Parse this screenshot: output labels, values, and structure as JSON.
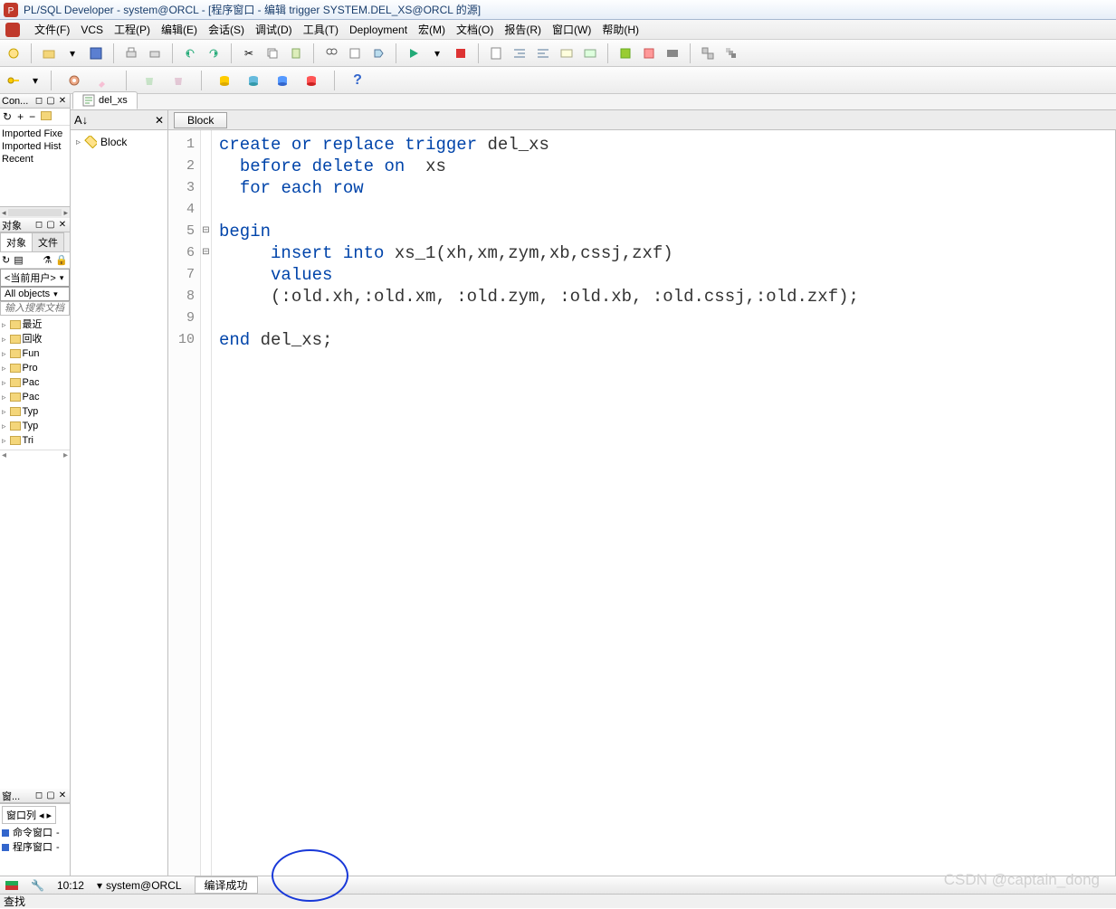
{
  "title": "PL/SQL Developer - system@ORCL - [程序窗口 - 编辑 trigger SYSTEM.DEL_XS@ORCL 的源]",
  "menus": [
    "文件(F)",
    "VCS",
    "工程(P)",
    "编辑(E)",
    "会话(S)",
    "调试(D)",
    "工具(T)",
    "Deployment",
    "宏(M)",
    "文档(O)",
    "报告(R)",
    "窗口(W)",
    "帮助(H)"
  ],
  "left": {
    "connections": {
      "title": "Con...",
      "rows": [
        "Imported Fixe",
        "Imported Hist",
        "Recent"
      ]
    },
    "objects": {
      "title": "对象",
      "tabs": [
        "对象",
        "文件"
      ],
      "user": "<当前用户>",
      "filter": "All objects",
      "search_placeholder": "输入搜索文档",
      "tree": [
        "最近",
        "回收",
        "Fun",
        "Pro",
        "Pac",
        "Pac",
        "Typ",
        "Typ",
        "Tri"
      ]
    },
    "windows": {
      "title": "窗...",
      "tab": "窗口列",
      "items": [
        "命令窗口",
        "程序窗口"
      ]
    }
  },
  "doc_tab": "del_xs",
  "block_button": "Block",
  "struct_node": "Block",
  "code_lines": [
    {
      "n": 1,
      "fold": "",
      "html": "<span class='kw'>create</span> <span class='kw'>or</span> <span class='kw'>replace</span> <span class='kw'>trigger</span> del_xs"
    },
    {
      "n": 2,
      "fold": "",
      "html": "  <span class='kw'>before</span> <span class='kw'>delete</span> <span class='kw'>on</span>  xs"
    },
    {
      "n": 3,
      "fold": "",
      "html": "  <span class='kw'>for</span> <span class='kw'>each</span> <span class='kw'>row</span>"
    },
    {
      "n": 4,
      "fold": "",
      "html": ""
    },
    {
      "n": 5,
      "fold": "⊟",
      "html": "<span class='kw'>begin</span>"
    },
    {
      "n": 6,
      "fold": "⊟",
      "html": "     <span class='kw'>insert</span> <span class='kw'>into</span> xs_1(xh,xm,zym,xb,cssj,zxf)"
    },
    {
      "n": 7,
      "fold": "",
      "html": "     <span class='kw'>values</span>"
    },
    {
      "n": 8,
      "fold": "",
      "html": "     (:old.xh,:old.xm, :old.zym, :old.xb, :old.cssj,:old.zxf);"
    },
    {
      "n": 9,
      "fold": "",
      "html": ""
    },
    {
      "n": 10,
      "fold": "",
      "html": "<span class='kw'>end</span> del_xs;"
    }
  ],
  "status": {
    "time": "10:12",
    "session": "system@ORCL",
    "compile": "编译成功"
  },
  "findbar": "查找",
  "watermark": "CSDN @captain_dong"
}
